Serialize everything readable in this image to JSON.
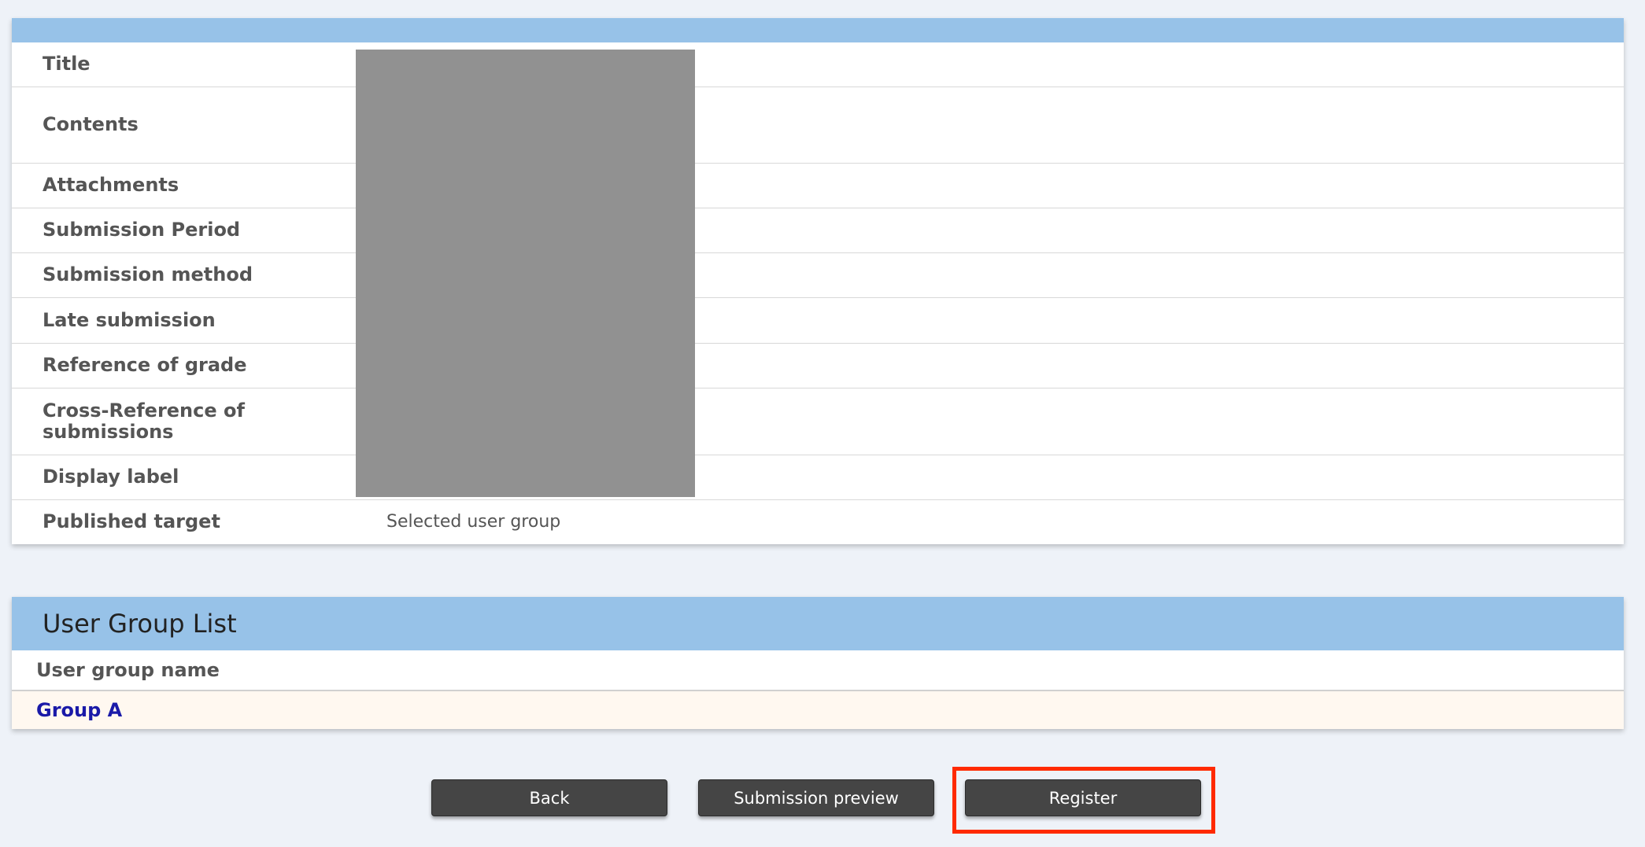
{
  "details": {
    "rows": [
      {
        "label": "Title",
        "value": ""
      },
      {
        "label": "Contents",
        "value": ""
      },
      {
        "label": "Attachments",
        "value": ""
      },
      {
        "label": "Submission Period",
        "value": ""
      },
      {
        "label": "Submission method",
        "value": ""
      },
      {
        "label": "Late submission",
        "value": ""
      },
      {
        "label": "Reference of grade",
        "value": ""
      },
      {
        "label": "Cross-Reference of submissions",
        "value": ""
      },
      {
        "label": "Display label",
        "value": ""
      },
      {
        "label": "Published target",
        "value": "Selected user group"
      }
    ]
  },
  "user_groups": {
    "title": "User Group List",
    "column_header": "User group name",
    "items": [
      "Group A"
    ]
  },
  "buttons": {
    "back": "Back",
    "preview": "Submission preview",
    "register": "Register"
  },
  "colors": {
    "header_bar": "#97c2e8",
    "button_bg": "#454545",
    "highlight": "#ff2a00",
    "group_link": "#1a1aa8",
    "group_row_bg": "#fff8f0"
  }
}
